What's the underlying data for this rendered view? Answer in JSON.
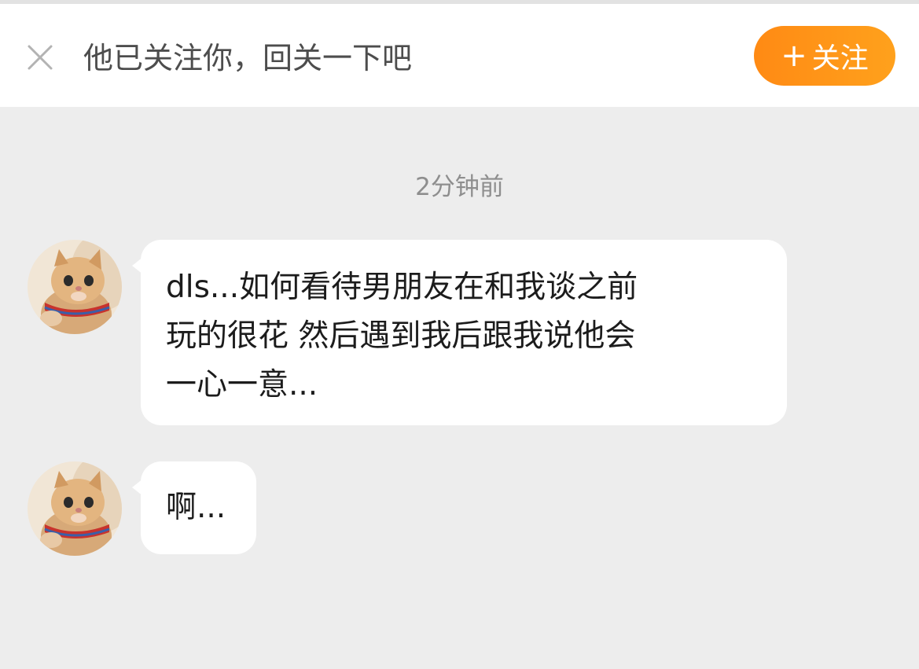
{
  "follow_bar": {
    "close_icon": "close-icon",
    "prompt": "他已关注你，回关一下吧",
    "follow_button": {
      "plus": "+",
      "label": "关注"
    },
    "accent_color": "#ff9418"
  },
  "chat": {
    "timestamp": "2分钟前",
    "messages": [
      {
        "sender": "other",
        "avatar": "cat-avatar",
        "lines": [
          "dls...如何看待男朋友在和我谈之前",
          "玩的很花 然后遇到我后跟我说他会",
          "一心一意..."
        ]
      },
      {
        "sender": "other",
        "avatar": "cat-avatar",
        "lines": [
          "啊..."
        ]
      }
    ]
  }
}
